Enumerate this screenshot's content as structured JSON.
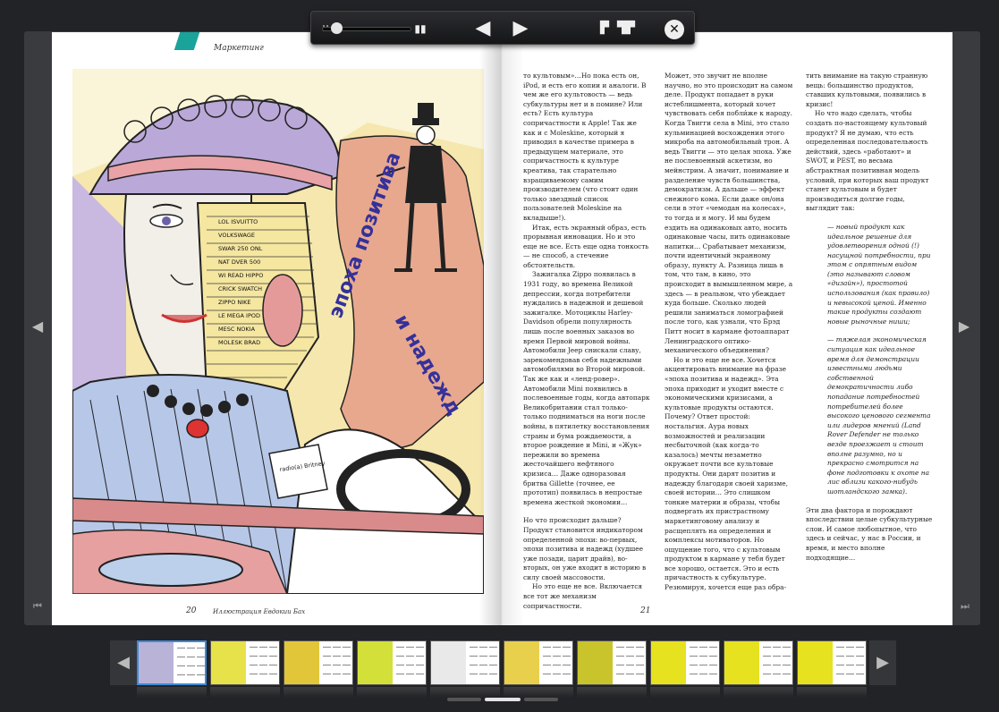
{
  "toolbar": {
    "buttons": [
      "zoom-slider",
      "two-page-view",
      "previous-page",
      "next-page",
      "single-page-view",
      "double-page-view",
      "close"
    ]
  },
  "page_left": {
    "section": "Маркетинг",
    "page_number": "20",
    "credit": "Иллюстрация Евдокии Бах"
  },
  "illustration": {
    "label_top": "эпоха позитива",
    "label_bottom": "и надежд",
    "face_words": "LOL, ISVUITTO, VOLKSWAGE, SWAR, 250 ONL, NAT, DVER 500, WI, READ, HIPPO, CRICK, SWATCH, ZIPPO, NIKE, LE MEGA, IPOD, MESC, NOKIA, MOLESK, BRAD",
    "tag_text": "radio(a) Britney"
  },
  "page_right": {
    "page_number": "21",
    "col1": [
      "то культовым»…Но пока есть он, iPod, и есть его копии и аналоги. В чем же его культовость — ведь субкультуры нет и в помине? Или есть? Есть культура сопричастности к Apple! Так же как и с Moleskine, который я приводил в качестве примера в предыдущем материале, это сопричастность к культуре креатива, так старательно взращиваемому самим производителем (что стоит один только звездный список пользователей Moleskine на вкладыше!).",
      "Итак, есть экранный образ, есть прорывная инновация. Но и это еще не все. Есть еще одна тонкость — не способ, а стечение обстоятельств.",
      "Зажигалка Zippo появилась в 1931 году, во времена Великой депрессии, когда потребители нуждались в надежной и дешевой зажигалке. Мотоциклы Harley-Davidson обрели популярность лишь после военных заказов во время Первой мировой войны. Автомобили Jeep снискали славу, зарекомендовав себя надежными автомобилями во Второй мировой. Так же как и «ленд-ровер». Автомобили Mini появились в послевоенные годы, когда автопарк Великобритании стал только-только подниматься на ноги после войны, в пятилетку восстановления страны и бума рождаемости, а второе рождение и Mini, и «Жук» пережили во времена жесточайшего нефтяного кризиса… Даже одноразовая бритва Gillette (точнее, ее прототип) появилась в непростые времена жесткой экономии…",
      "Но что происходит дальше? Продукт становится индикатором определенной эпохи: во-первых, эпохи позитива и надежд (худшее уже позади, царит драйв), во-вторых, он уже входит в историю в силу своей массовости.",
      "Но это еще не все. Включается все тот же механизм сопричастности."
    ],
    "col2": [
      "Может, это звучит не вполне научно, но это происходит на самом деле. Продукт попадает в руки истеблишмента, который хочет чувствовать себя побли́же к народу. Когда Твигги села в Mini, это стало кульминацией восхождения этого микроба на автомобильный трон. А ведь Твигги — это целая эпоха. Уже не послевоенный аскетизм, но мейнстрим. А значит, понимание и разделение чувств большинства, демократизм. А дальше — эффект снежного кома. Если даже он/она сели в этот «чемодан на колесах», то тогда и я могу. И мы будем ездить на одинаковых авто, носить одинаковые часы, пить одинаковые напитки… Срабатывает механизм, почти идентичный экранному образу, пункту А. Разница лишь в том, что там, в кино, это происходит в вымышленном мире, а здесь — в реальном, что убеждает куда больше. Сколько людей решили заниматься ломографией после того, как узнали, что Брэд Питт носит в кармане фотоаппарат Ленинградского оптико-механического объединения?",
      "Но и это еще не все. Хочется акцентировать внимание на фразе «эпоха позитива и надежд». Эта эпоха приходит и уходит вместе с экономическими кризисами, а культовые продукты остаются. Почему? Ответ простой: ностальгия. Аура новых возможностей и реализации несбыточной (как когда-то казалось) мечты незаметно окружает почти все культовые продукты. Они дарят позитив и надежду благодаря своей харизме, своей истории… Это слишком тонкие материи и образы, чтобы подвергать их пристрастному маркетинговому анализу и расщеплять на определения и комплексы мотиваторов. Но ощущение того, что с культовым продуктом в кармане у тебя будет все хорошо, остается. Это и есть причастность к субкультуре. Резюмируя, хочется еще раз обра-"
    ],
    "col3_intro": "тить внимание на такую странную вещь: большинство продуктов, ставших культовыми, появились в кризис!",
    "col3_p2": "Но что надо сделать, чтобы создать по-настоящему культовый продукт? Я не думаю, что есть определенная последовательность действий, здесь «работают» и SWOT, и PEST, но весьма абстрактная позитивная модель условий, при которых ваш продукт станет культовым и будет производиться долгие годы, выглядит так:",
    "col3_list": [
      "— новый продукт как идеальное решение для удовлетворения одной (!) насущной потребности, при этом с опрятным видом (это называют словом «дизайн»), простотой использования (как правило) и невысокой ценой. Именно такие продукты создают новые рыночные ниши;",
      "— тяжелая экономическая ситуация как идеальное время для демонстрации известными людьми собственной демократичности либо попадание потребностей потребителей более высокого ценового сегмента или лидеров мнений (Land Rover Defender не только везде проезжает и стоит вполне разумно, но и прекрасно смотрится на фоне подготовки к охоте на лис вблизи какого-нибудь шотландского замка)."
    ],
    "col3_end": "Эти два фактора и порождают впоследствии целые субкультурные слои. И самое любопытное, что здесь и сейчас, у нас в России, и время, и место вполне подходящие…"
  },
  "thumbnails": [
    {
      "name": "thumb-1",
      "selected": true,
      "accent": "#b9b3d8"
    },
    {
      "name": "thumb-2",
      "selected": false,
      "accent": "#e7e24a"
    },
    {
      "name": "thumb-3",
      "selected": false,
      "accent": "#e2c63a"
    },
    {
      "name": "thumb-4",
      "selected": false,
      "accent": "#d4e03a"
    },
    {
      "name": "thumb-5",
      "selected": false,
      "accent": "#e9e9e9"
    },
    {
      "name": "thumb-6",
      "selected": false,
      "accent": "#e8d04c"
    },
    {
      "name": "thumb-7",
      "selected": false,
      "accent": "#c9c42c"
    },
    {
      "name": "thumb-8",
      "selected": false,
      "accent": "#e6e21f"
    },
    {
      "name": "thumb-9",
      "selected": false,
      "accent": "#e6e21f"
    },
    {
      "name": "thumb-10",
      "selected": false,
      "accent": "#e6e21f"
    }
  ]
}
